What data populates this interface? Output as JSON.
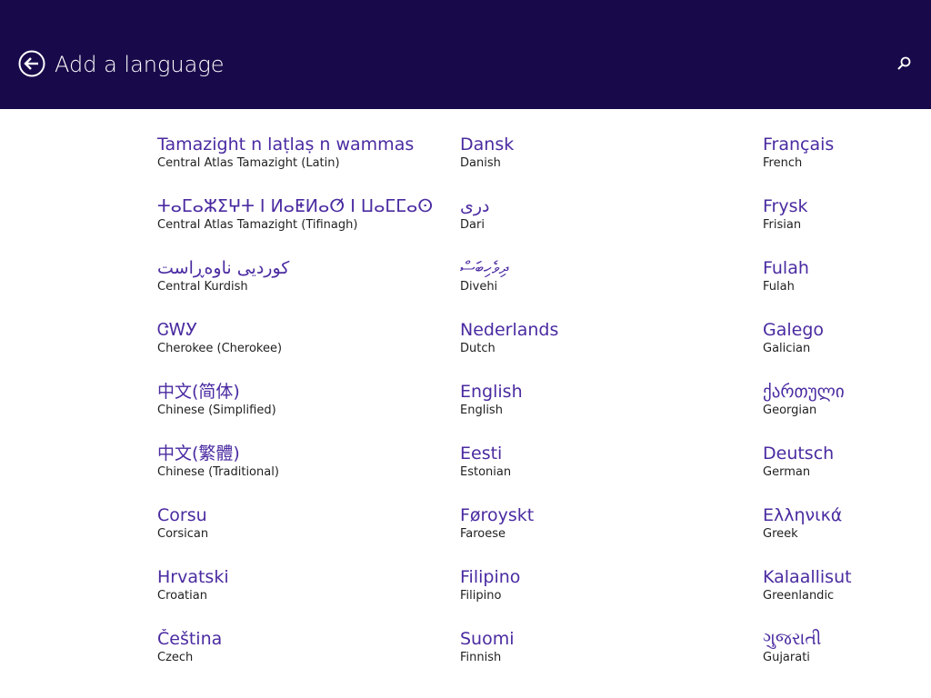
{
  "header": {
    "title": "Add a language",
    "back_icon": "back-arrow-circle-icon",
    "search_icon": "search-icon",
    "background_color": "#180a4a"
  },
  "accent_color": "#4a2ba1",
  "languages": {
    "column1": [
      {
        "native": "Tamazight n laṭlaṣ n wammas",
        "english": "Central Atlas Tamazight (Latin)"
      },
      {
        "native": "ⵜⴰⵎⴰⵣⵉⵖⵜ ⵏ ⵍⴰⵟⵍⴰⵚ ⵏ ⵡⴰⵎⵎⴰⵙ",
        "english": "Central Atlas Tamazight (Tifinagh)"
      },
      {
        "native": "کوردیی ناوەڕاست",
        "english": "Central Kurdish"
      },
      {
        "native": "ᏣᎳᎩ",
        "english": "Cherokee (Cherokee)"
      },
      {
        "native": "中文(简体)",
        "english": "Chinese (Simplified)"
      },
      {
        "native": "中文(繁體)",
        "english": "Chinese (Traditional)"
      },
      {
        "native": "Corsu",
        "english": "Corsican"
      },
      {
        "native": "Hrvatski",
        "english": "Croatian"
      },
      {
        "native": "Čeština",
        "english": "Czech"
      }
    ],
    "column2": [
      {
        "native": "Dansk",
        "english": "Danish"
      },
      {
        "native": "دری",
        "english": "Dari"
      },
      {
        "native": "ދިވެހިބަސް",
        "english": "Divehi"
      },
      {
        "native": "Nederlands",
        "english": "Dutch"
      },
      {
        "native": "English",
        "english": "English"
      },
      {
        "native": "Eesti",
        "english": "Estonian"
      },
      {
        "native": "Føroyskt",
        "english": "Faroese"
      },
      {
        "native": "Filipino",
        "english": "Filipino"
      },
      {
        "native": "Suomi",
        "english": "Finnish"
      }
    ],
    "column3": [
      {
        "native": "Français",
        "english": "French"
      },
      {
        "native": "Frysk",
        "english": "Frisian"
      },
      {
        "native": "Fulah",
        "english": "Fulah"
      },
      {
        "native": "Galego",
        "english": "Galician"
      },
      {
        "native": "ქართული",
        "english": "Georgian"
      },
      {
        "native": "Deutsch",
        "english": "German"
      },
      {
        "native": "Ελληνικά",
        "english": "Greek"
      },
      {
        "native": "Kalaallisut",
        "english": "Greenlandic"
      },
      {
        "native": "ગુજરાતી",
        "english": "Gujarati"
      }
    ]
  }
}
